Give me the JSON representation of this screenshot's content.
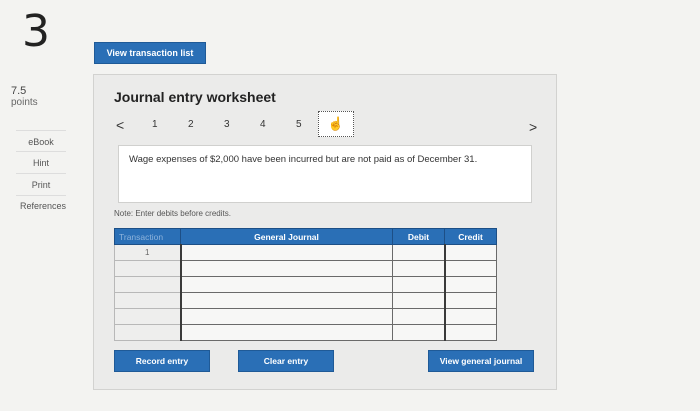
{
  "question": {
    "number": "3",
    "points_value": "7.5",
    "points_label": "points"
  },
  "sidebar": {
    "links": [
      {
        "label": "eBook"
      },
      {
        "label": "Hint"
      },
      {
        "label": "Print"
      },
      {
        "label": "References"
      }
    ]
  },
  "header": {
    "view_transaction_label": "View transaction list"
  },
  "worksheet": {
    "title": "Journal entry worksheet",
    "prev_arrow": "<",
    "next_arrow": ">",
    "steps": [
      "1",
      "2",
      "3",
      "4",
      "5"
    ],
    "current_step_icon": "hand-pointer-icon",
    "description": "Wage expenses of $2,000 have been incurred but are not paid as of December 31.",
    "note": "Note: Enter debits before credits.",
    "table": {
      "headers": {
        "transaction": "Transaction",
        "account": "General Journal",
        "debit": "Debit",
        "credit": "Credit"
      },
      "rows": [
        {
          "transaction": "1",
          "account": "",
          "debit": "",
          "credit": ""
        },
        {
          "transaction": "",
          "account": "",
          "debit": "",
          "credit": ""
        },
        {
          "transaction": "",
          "account": "",
          "debit": "",
          "credit": ""
        },
        {
          "transaction": "",
          "account": "",
          "debit": "",
          "credit": ""
        },
        {
          "transaction": "",
          "account": "",
          "debit": "",
          "credit": ""
        },
        {
          "transaction": "",
          "account": "",
          "debit": "",
          "credit": ""
        }
      ]
    },
    "buttons": {
      "record": "Record entry",
      "clear": "Clear entry",
      "view_journal": "View general journal"
    }
  }
}
